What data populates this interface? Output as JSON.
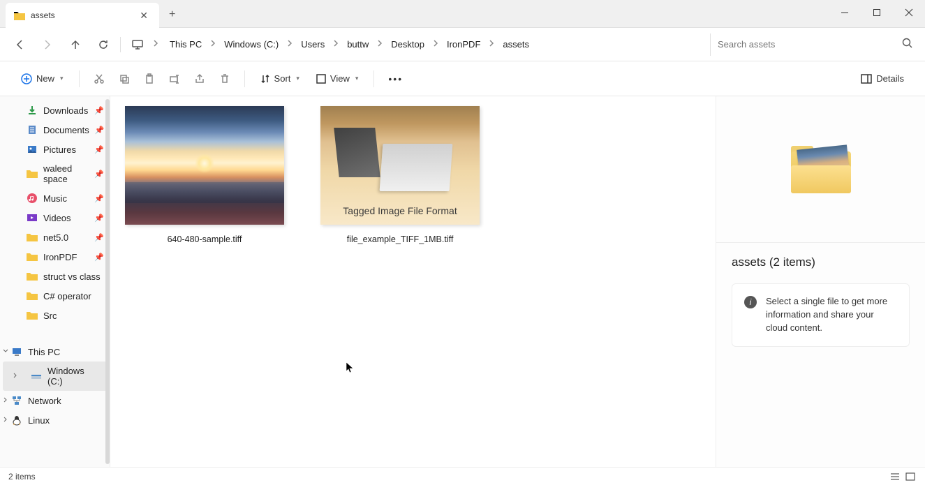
{
  "tab": {
    "title": "assets"
  },
  "breadcrumbs": [
    "This PC",
    "Windows (C:)",
    "Users",
    "buttw",
    "Desktop",
    "IronPDF",
    "assets"
  ],
  "search": {
    "placeholder": "Search assets"
  },
  "toolbar": {
    "new": "New",
    "sort": "Sort",
    "view": "View",
    "details": "Details"
  },
  "sidebar": {
    "quick": [
      {
        "name": "Downloads",
        "icon": "download",
        "pinned": true
      },
      {
        "name": "Documents",
        "icon": "doc",
        "pinned": true
      },
      {
        "name": "Pictures",
        "icon": "pic",
        "pinned": true
      },
      {
        "name": "waleed space",
        "icon": "folder",
        "pinned": true
      },
      {
        "name": "Music",
        "icon": "music",
        "pinned": true
      },
      {
        "name": "Videos",
        "icon": "video",
        "pinned": true
      },
      {
        "name": "net5.0",
        "icon": "folder",
        "pinned": true
      },
      {
        "name": "IronPDF",
        "icon": "folder",
        "pinned": true
      },
      {
        "name": "struct vs class",
        "icon": "folder",
        "pinned": false
      },
      {
        "name": "C# operator",
        "icon": "folder",
        "pinned": false
      },
      {
        "name": "Src",
        "icon": "folder",
        "pinned": false
      }
    ],
    "thispc": "This PC",
    "drive": "Windows (C:)",
    "network": "Network",
    "linux": "Linux"
  },
  "files": [
    {
      "name": "640-480-sample.tiff"
    },
    {
      "name": "file_example_TIFF_1MB.tiff",
      "overlay": "Tagged Image File Format"
    }
  ],
  "details": {
    "title": "assets (2 items)",
    "info": "Select a single file to get more information and share your cloud content."
  },
  "status": {
    "count": "2 items"
  }
}
